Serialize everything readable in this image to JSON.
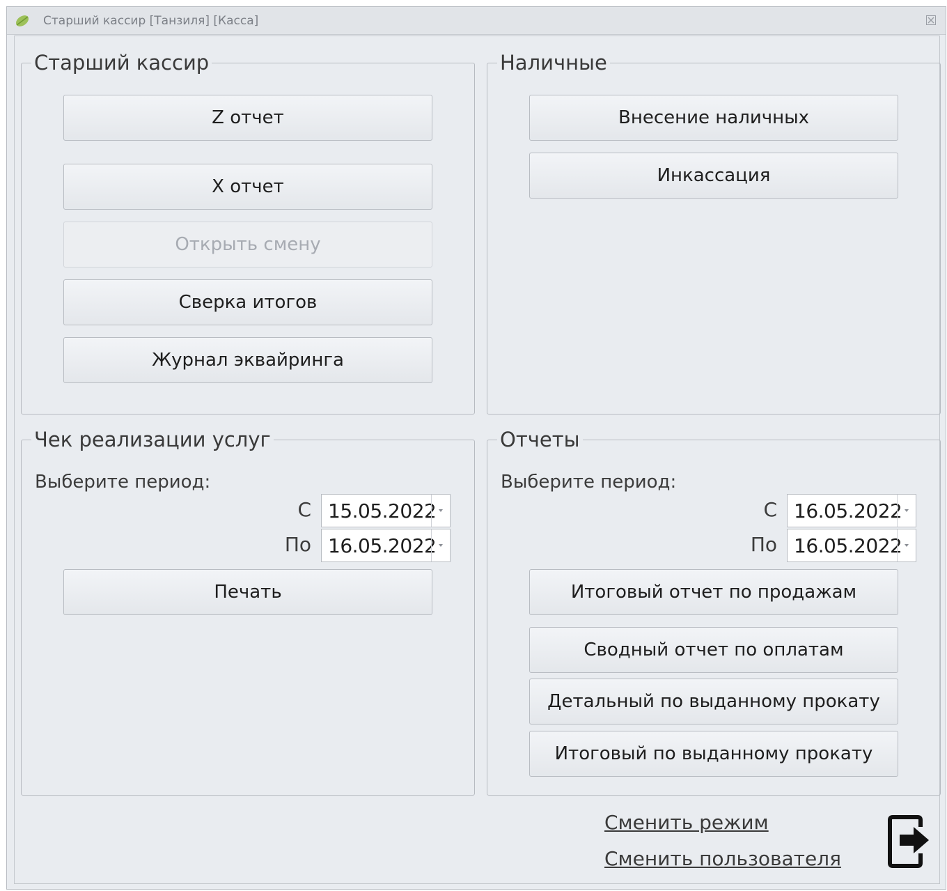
{
  "window": {
    "title": "Старший кассир [Танзиля] [Касса]",
    "icons": {
      "app": "leaf-icon",
      "close": "close-icon",
      "exit": "exit-door-arrow-icon"
    }
  },
  "senior_cashier": {
    "legend": "Старший кассир",
    "buttons": {
      "z_report": "Z отчет",
      "x_report": "X отчет",
      "open_shift": "Открыть смену",
      "reconciliation": "Сверка итогов",
      "acquiring_log": "Журнал эквайринга"
    }
  },
  "cash": {
    "legend": "Наличные",
    "buttons": {
      "deposit": "Внесение наличных",
      "collection": "Инкассация"
    }
  },
  "services_receipt": {
    "legend": "Чек реализации услуг",
    "period_label": "Выберите период:",
    "from_label": "С",
    "from_value": "15.05.2022",
    "to_label": "По",
    "to_value": "16.05.2022",
    "print_button": "Печать"
  },
  "reports": {
    "legend": "Отчеты",
    "period_label": "Выберите период:",
    "from_label": "С",
    "from_value": "16.05.2022",
    "to_label": "По",
    "to_value": "16.05.2022",
    "buttons": {
      "sales_summary": "Итоговый отчет по продажам",
      "payments_summary": "Сводный отчет по оплатам",
      "rental_detailed": "Детальный по выданному прокату",
      "rental_total": "Итоговый по выданному прокату"
    }
  },
  "footer": {
    "change_mode": "Сменить режим",
    "change_user": "Сменить пользователя"
  }
}
